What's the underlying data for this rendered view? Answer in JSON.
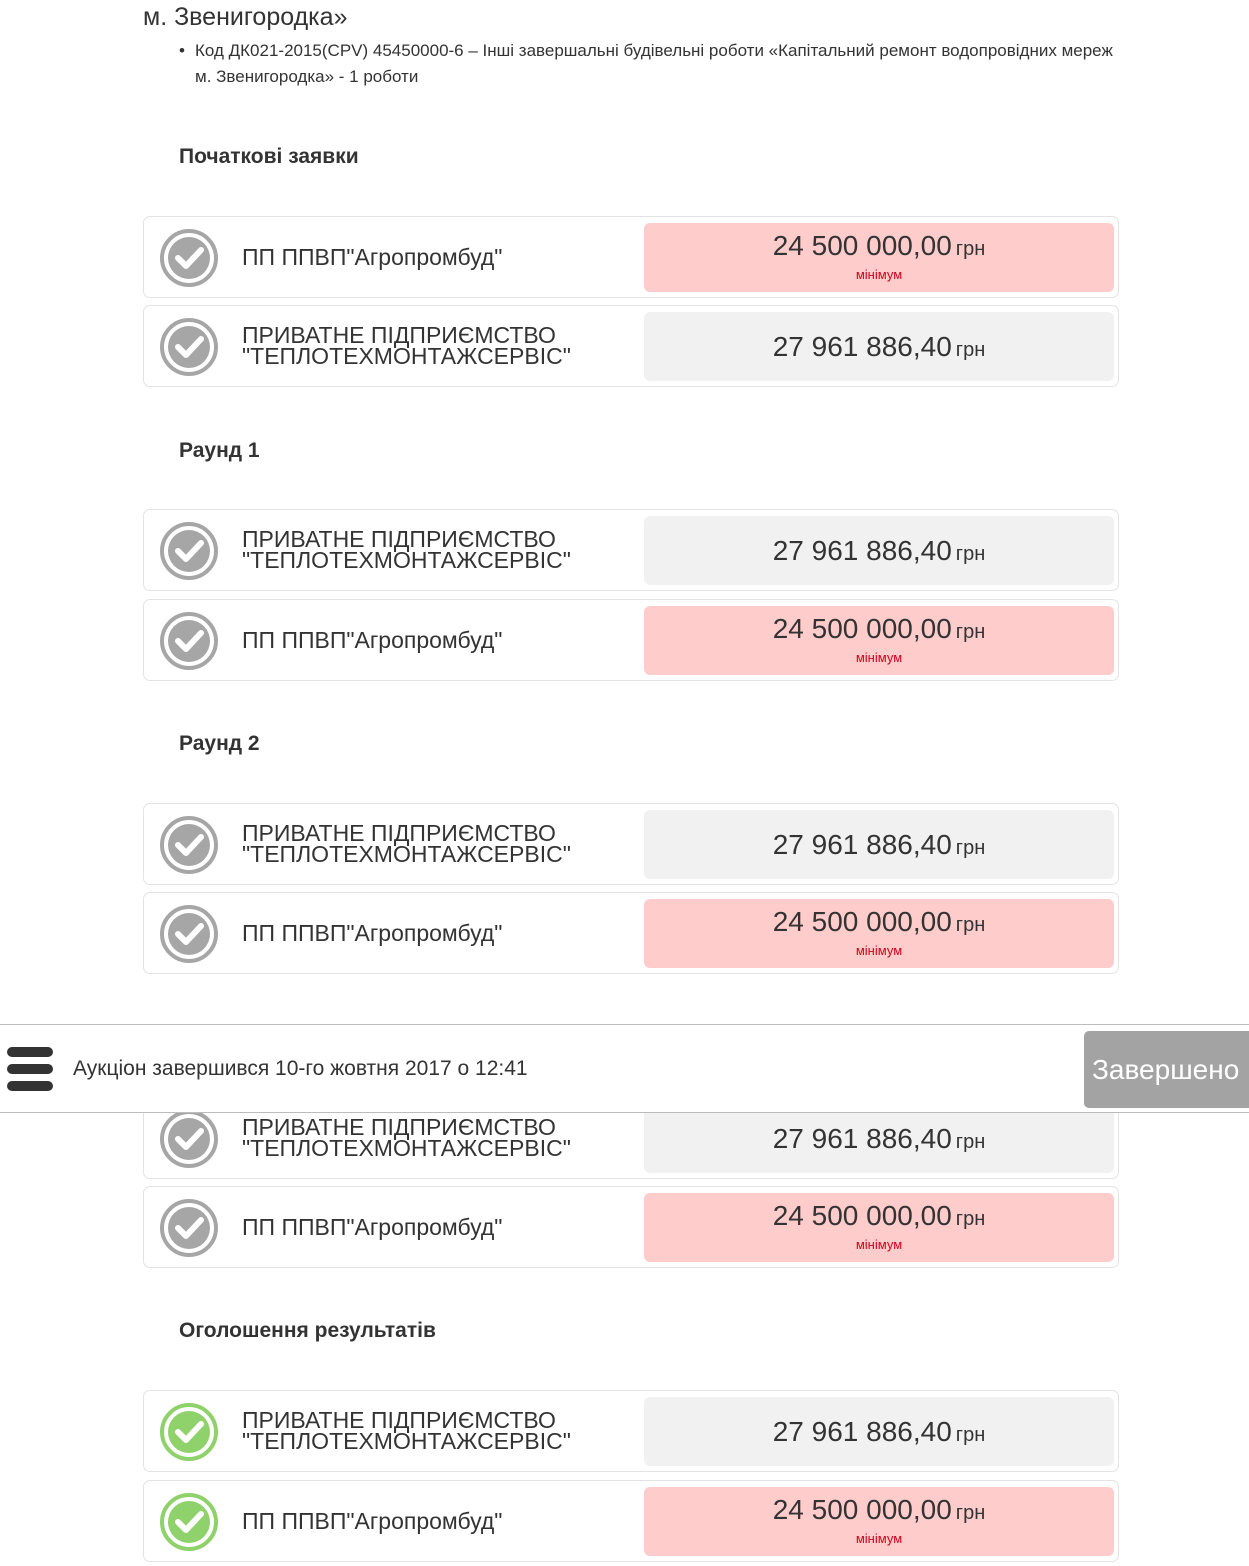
{
  "header": {
    "title": "м. Звенигородка»",
    "cpv_bullet": "•",
    "cpv_text": "Код ДК021-2015(CPV) 45450000-6 – Інші завершальні будівельні роботи «Капітальний ремонт водопровідних мереж м. Звенигородка» - 1 роботи"
  },
  "sections": [
    {
      "title": "Початкові заявки",
      "rows": [
        {
          "name": "ПП ППВП\"Агропромбуд\"",
          "amount": "24 500 000,00",
          "currency": "грн",
          "note": "мінімум",
          "status": "gray"
        },
        {
          "name": "ПРИВАТНЕ ПІДПРИЄМСТВО\n\"ТЕПЛОТЕХМОНТАЖСЕРВІС\"",
          "amount": "27 961 886,40",
          "currency": "грн",
          "note": "",
          "status": "gray"
        }
      ]
    },
    {
      "title": "Раунд 1",
      "rows": [
        {
          "name": "ПРИВАТНЕ ПІДПРИЄМСТВО\n\"ТЕПЛОТЕХМОНТАЖСЕРВІС\"",
          "amount": "27 961 886,40",
          "currency": "грн",
          "note": "",
          "status": "gray"
        },
        {
          "name": "ПП ППВП\"Агропромбуд\"",
          "amount": "24 500 000,00",
          "currency": "грн",
          "note": "мінімум",
          "status": "gray"
        }
      ]
    },
    {
      "title": "Раунд 2",
      "rows": [
        {
          "name": "ПРИВАТНЕ ПІДПРИЄМСТВО\n\"ТЕПЛОТЕХМОНТАЖСЕРВІС\"",
          "amount": "27 961 886,40",
          "currency": "грн",
          "note": "",
          "status": "gray"
        },
        {
          "name": "ПП ППВП\"Агропромбуд\"",
          "amount": "24 500 000,00",
          "currency": "грн",
          "note": "мінімум",
          "status": "gray"
        }
      ]
    },
    {
      "title": "",
      "rows": [
        {
          "name": "ПРИВАТНЕ ПІДПРИЄМСТВО\n\"ТЕПЛОТЕХМОНТАЖСЕРВІС\"",
          "amount": "27 961 886,40",
          "currency": "грн",
          "note": "",
          "status": "gray"
        },
        {
          "name": "ПП ППВП\"Агропромбуд\"",
          "amount": "24 500 000,00",
          "currency": "грн",
          "note": "мінімум",
          "status": "gray"
        }
      ]
    },
    {
      "title": "Оголошення результатів",
      "rows": [
        {
          "name": "ПРИВАТНЕ ПІДПРИЄМСТВО\n\"ТЕПЛОТЕХМОНТАЖСЕРВІС\"",
          "amount": "27 961 886,40",
          "currency": "грн",
          "note": "",
          "status": "green"
        },
        {
          "name": "ПП ППВП\"Агропромбуд\"",
          "amount": "24 500 000,00",
          "currency": "грн",
          "note": "мінімум",
          "status": "green"
        }
      ]
    }
  ],
  "footer": {
    "menu_icon": "hamburger-menu-icon",
    "status_text": "Аукціон завершився 10-го жовтня 2017 о 12:41",
    "button_label": "Завершено"
  },
  "colors": {
    "status_gray": "#a6a6a6",
    "status_green": "#8fd16b",
    "min_bg": "#ffcccc",
    "min_note": "#d0021b",
    "amount_bg": "#f1f1f1",
    "finished_btn": "#a3a3a3"
  }
}
